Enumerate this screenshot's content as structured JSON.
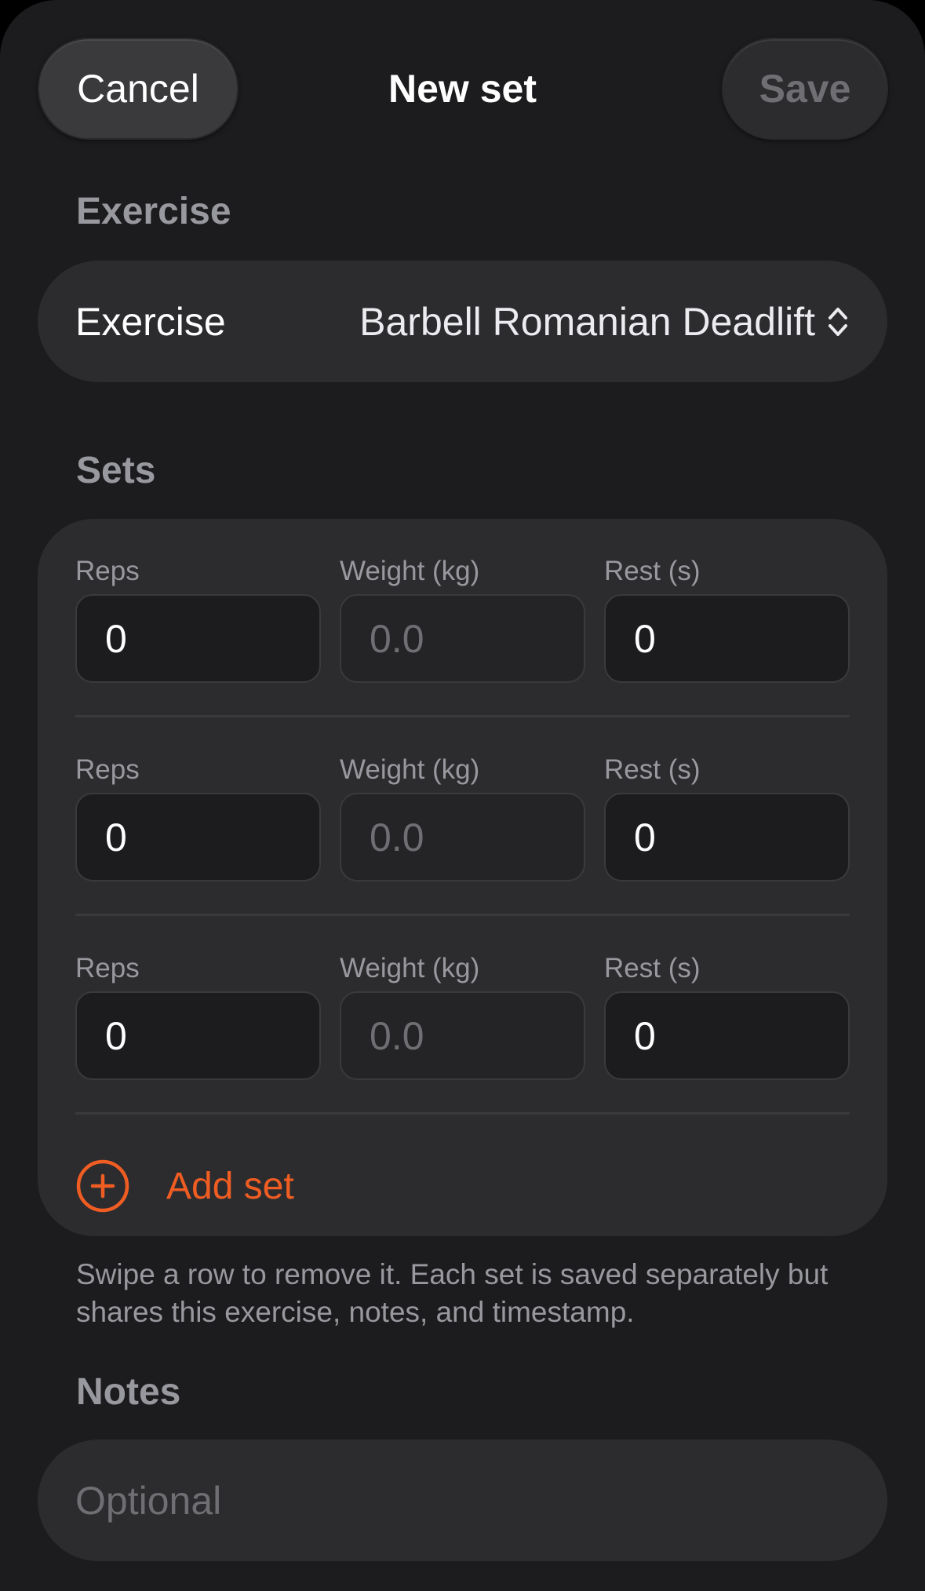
{
  "nav": {
    "title": "New set",
    "cancel_label": "Cancel",
    "save_label": "Save"
  },
  "exercise_section": {
    "header": "Exercise",
    "row_label": "Exercise",
    "selected_value": "Barbell Romanian Deadlift",
    "picker_icon": "chevron-up-down-icon"
  },
  "sets_section": {
    "header": "Sets",
    "rows": [
      {
        "reps_label": "Reps",
        "reps_value": "0",
        "weight_label": "Weight (kg)",
        "weight_placeholder": "0.0",
        "rest_label": "Rest (s)",
        "rest_value": "0"
      },
      {
        "reps_label": "Reps",
        "reps_value": "0",
        "weight_label": "Weight (kg)",
        "weight_placeholder": "0.0",
        "rest_label": "Rest (s)",
        "rest_value": "0"
      },
      {
        "reps_label": "Reps",
        "reps_value": "0",
        "weight_label": "Weight (kg)",
        "weight_placeholder": "0.0",
        "rest_label": "Rest (s)",
        "rest_value": "0"
      }
    ],
    "add_set_label": "Add set",
    "add_icon": "plus-circle-icon",
    "footnote": "Swipe a row to remove it. Each set is saved separately but shares this exercise, notes, and timestamp."
  },
  "notes_section": {
    "header": "Notes",
    "placeholder": "Optional"
  },
  "colors": {
    "background": "#1c1c1e",
    "card": "#2c2c2e",
    "accent": "#f05d23",
    "secondary_text": "#98989f"
  }
}
